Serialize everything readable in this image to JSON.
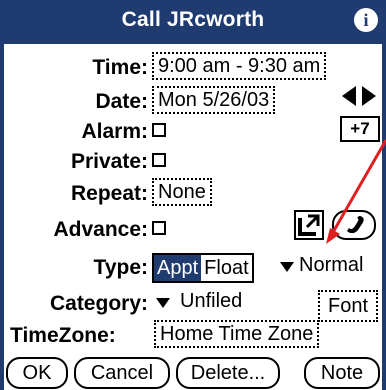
{
  "title": "Call JRcworth",
  "info_icon": "i",
  "fields": {
    "time_label": "Time:",
    "time_value": "9:00 am - 9:30 am",
    "date_label": "Date:",
    "date_value": "Mon 5/26/03",
    "alarm_label": "Alarm:",
    "private_label": "Private:",
    "repeat_label": "Repeat:",
    "repeat_value": "None",
    "advance_label": "Advance:",
    "type_label": "Type:",
    "type_options": [
      "Appt",
      "Float"
    ],
    "type_selected": "Appt",
    "type_dropdown": "Normal",
    "category_label": "Category:",
    "category_value": "Unfiled",
    "timezone_label": "TimeZone:",
    "timezone_value": "Home Time Zone"
  },
  "plus7_label": "+7",
  "font_button": "Font",
  "buttons": {
    "ok": "OK",
    "cancel": "Cancel",
    "delete": "Delete...",
    "note": "Note"
  },
  "colors": {
    "titlebar": "#1f3b6f",
    "annotation_arrow": "#e02020"
  },
  "icons": [
    "info-icon",
    "prev-day-arrow-icon",
    "next-day-arrow-icon",
    "checkbox-icon",
    "expand-icon",
    "phone-icon",
    "dropdown-triangle-icon"
  ]
}
